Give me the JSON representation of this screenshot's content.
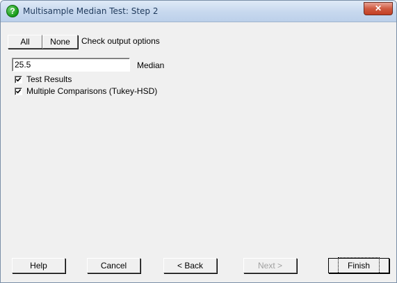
{
  "window": {
    "title": "Multisample Median Test: Step 2",
    "close_glyph": "✕",
    "title_icon_glyph": "?",
    "title_icon": "question-icon"
  },
  "toolbar": {
    "all_label": "All",
    "none_label": "None",
    "caption": "Check output options"
  },
  "median": {
    "value": "25.5",
    "label": "Median"
  },
  "options": [
    {
      "label": "Test Results",
      "checked": true
    },
    {
      "label": "Multiple Comparisons (Tukey-HSD)",
      "checked": true
    }
  ],
  "footer": {
    "help_label": "Help",
    "cancel_label": "Cancel",
    "back_label": "< Back",
    "next_label": "Next >",
    "finish_label": "Finish",
    "next_enabled": false
  }
}
